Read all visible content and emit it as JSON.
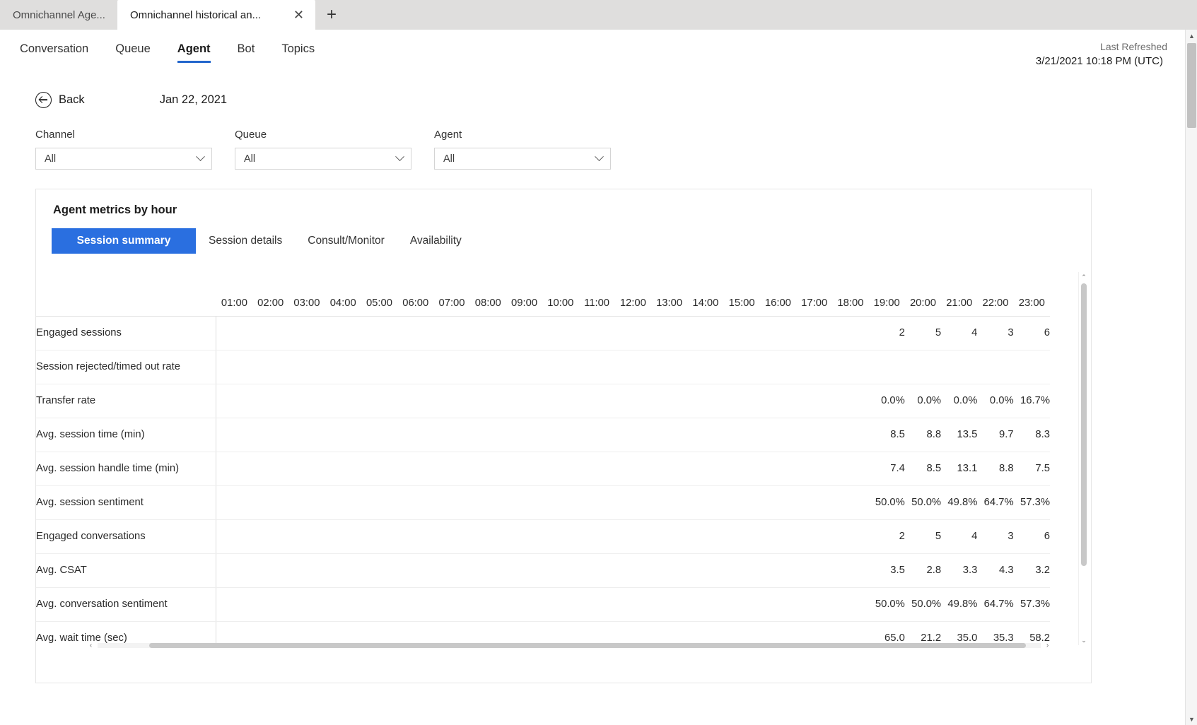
{
  "browser": {
    "tabs": [
      {
        "title": "Omnichannel Age...",
        "active": false
      },
      {
        "title": "Omnichannel historical an...",
        "active": true
      }
    ],
    "close_glyph": "✕",
    "newtab_glyph": "+"
  },
  "nav": {
    "items": [
      {
        "label": "Conversation",
        "active": false
      },
      {
        "label": "Queue",
        "active": false
      },
      {
        "label": "Agent",
        "active": true
      },
      {
        "label": "Bot",
        "active": false
      },
      {
        "label": "Topics",
        "active": false
      }
    ],
    "last_refreshed_label": "Last Refreshed",
    "last_refreshed_value": "3/21/2021 10:18 PM (UTC)"
  },
  "toolbar": {
    "back_label": "Back",
    "date_label": "Jan 22, 2021"
  },
  "filters": [
    {
      "label": "Channel",
      "value": "All"
    },
    {
      "label": "Queue",
      "value": "All"
    },
    {
      "label": "Agent",
      "value": "All"
    }
  ],
  "card": {
    "title": "Agent metrics by hour",
    "subtabs": [
      {
        "label": "Session summary",
        "active": true
      },
      {
        "label": "Session details",
        "active": false
      },
      {
        "label": "Consult/Monitor",
        "active": false
      },
      {
        "label": "Availability",
        "active": false
      }
    ]
  },
  "chart_data": {
    "type": "table",
    "title": "Agent metrics by hour",
    "row_header": "",
    "categories": [
      "01:00",
      "02:00",
      "03:00",
      "04:00",
      "05:00",
      "06:00",
      "07:00",
      "08:00",
      "09:00",
      "10:00",
      "11:00",
      "12:00",
      "13:00",
      "14:00",
      "15:00",
      "16:00",
      "17:00",
      "18:00",
      "19:00",
      "20:00",
      "21:00",
      "22:00",
      "23:00"
    ],
    "series": [
      {
        "name": "Engaged sessions",
        "values": [
          "",
          "",
          "",
          "",
          "",
          "",
          "",
          "",
          "",
          "",
          "",
          "",
          "",
          "",
          "",
          "",
          "",
          "",
          "2",
          "5",
          "4",
          "3",
          "6"
        ]
      },
      {
        "name": "Session rejected/timed out rate",
        "values": [
          "",
          "",
          "",
          "",
          "",
          "",
          "",
          "",
          "",
          "",
          "",
          "",
          "",
          "",
          "",
          "",
          "",
          "",
          "",
          "",
          "",
          "",
          ""
        ]
      },
      {
        "name": "Transfer rate",
        "values": [
          "",
          "",
          "",
          "",
          "",
          "",
          "",
          "",
          "",
          "",
          "",
          "",
          "",
          "",
          "",
          "",
          "",
          "",
          "0.0%",
          "0.0%",
          "0.0%",
          "0.0%",
          "16.7%"
        ]
      },
      {
        "name": "Avg. session time (min)",
        "values": [
          "",
          "",
          "",
          "",
          "",
          "",
          "",
          "",
          "",
          "",
          "",
          "",
          "",
          "",
          "",
          "",
          "",
          "",
          "8.5",
          "8.8",
          "13.5",
          "9.7",
          "8.3"
        ]
      },
      {
        "name": "Avg. session handle time (min)",
        "values": [
          "",
          "",
          "",
          "",
          "",
          "",
          "",
          "",
          "",
          "",
          "",
          "",
          "",
          "",
          "",
          "",
          "",
          "",
          "7.4",
          "8.5",
          "13.1",
          "8.8",
          "7.5"
        ]
      },
      {
        "name": "Avg. session sentiment",
        "values": [
          "",
          "",
          "",
          "",
          "",
          "",
          "",
          "",
          "",
          "",
          "",
          "",
          "",
          "",
          "",
          "",
          "",
          "",
          "50.0%",
          "50.0%",
          "49.8%",
          "64.7%",
          "57.3%"
        ]
      },
      {
        "name": "Engaged conversations",
        "values": [
          "",
          "",
          "",
          "",
          "",
          "",
          "",
          "",
          "",
          "",
          "",
          "",
          "",
          "",
          "",
          "",
          "",
          "",
          "2",
          "5",
          "4",
          "3",
          "6"
        ]
      },
      {
        "name": "Avg. CSAT",
        "values": [
          "",
          "",
          "",
          "",
          "",
          "",
          "",
          "",
          "",
          "",
          "",
          "",
          "",
          "",
          "",
          "",
          "",
          "",
          "3.5",
          "2.8",
          "3.3",
          "4.3",
          "3.2"
        ]
      },
      {
        "name": "Avg. conversation sentiment",
        "values": [
          "",
          "",
          "",
          "",
          "",
          "",
          "",
          "",
          "",
          "",
          "",
          "",
          "",
          "",
          "",
          "",
          "",
          "",
          "50.0%",
          "50.0%",
          "49.8%",
          "64.7%",
          "57.3%"
        ]
      },
      {
        "name": "Avg. wait time (sec)",
        "values": [
          "",
          "",
          "",
          "",
          "",
          "",
          "",
          "",
          "",
          "",
          "",
          "",
          "",
          "",
          "",
          "",
          "",
          "",
          "65.0",
          "21.2",
          "35.0",
          "35.3",
          "58.2"
        ]
      }
    ],
    "grid": true,
    "legend": "none"
  },
  "scroll": {
    "up_glyph": "▲",
    "down_glyph": "▼",
    "left_glyph": "◄",
    "right_glyph": "►",
    "small_up_glyph": "⌃",
    "small_down_glyph": "⌄",
    "small_left_glyph": "‹",
    "small_right_glyph": "›"
  },
  "colors": {
    "accent": "#2a6fe0",
    "nav_underline": "#2266cc",
    "text": "#1b1b1b"
  }
}
